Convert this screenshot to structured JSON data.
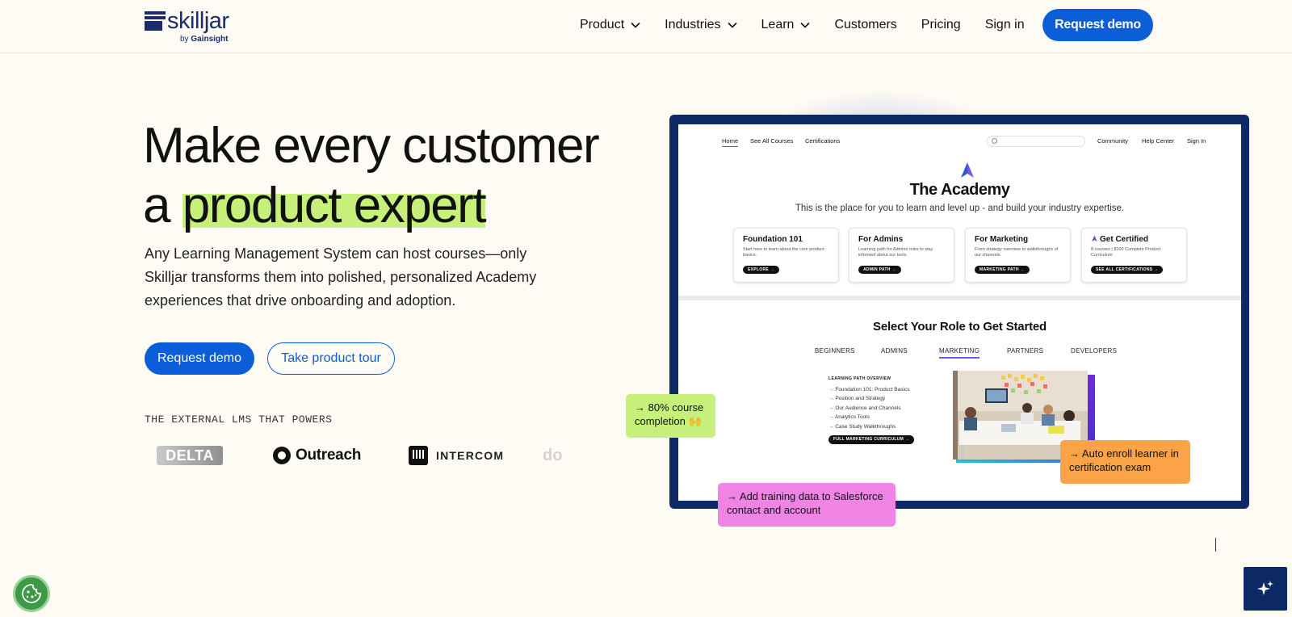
{
  "header": {
    "logo_word": "skilljar",
    "logo_by": "by",
    "logo_by_brand": "Gainsight",
    "nav": [
      {
        "label": "Product",
        "has_dropdown": true
      },
      {
        "label": "Industries",
        "has_dropdown": true
      },
      {
        "label": "Learn",
        "has_dropdown": true
      },
      {
        "label": "Customers",
        "has_dropdown": false
      },
      {
        "label": "Pricing",
        "has_dropdown": false
      },
      {
        "label": "Sign in",
        "has_dropdown": false
      }
    ],
    "cta": "Request demo"
  },
  "hero": {
    "title_line1": "Make every customer",
    "title_line2_prefix": "a ",
    "title_line2_highlight": "product expert",
    "lede": "Any Learning Management System can host courses—only Skilljar transforms them into polished, personalized Academy experiences that drive onboarding and adoption.",
    "primary_cta": "Request demo",
    "secondary_cta": "Take product tour",
    "powers_label": "THE EXTERNAL LMS THAT POWERS",
    "customer_logos": [
      "DELTA",
      "Outreach",
      "INTERCOM",
      "do"
    ]
  },
  "mockup": {
    "nav": {
      "home": "Home",
      "courses": "See All Courses",
      "certs": "Certifications",
      "community": "Community",
      "help": "Help Center",
      "signin": "Sign In"
    },
    "title": "The Academy",
    "subtitle": "This is the place for you to learn and level up - and build your industry expertise.",
    "cards": [
      {
        "title": "Foundation 101",
        "desc": "Start here to learn about the core product basics.",
        "button": "EXPLORE →"
      },
      {
        "title": "For Admins",
        "desc": "Learning path for Admins roles to stay informed about our tools.",
        "button": "ADMIN PATH →"
      },
      {
        "title": "For Marketing",
        "desc": "From strategy overview to walkthroughs of our channels.",
        "button": "MARKETING PATH →"
      },
      {
        "title": "Get Certified",
        "desc": "8 courses | $100 Complete Product Curriculum",
        "button": "SEE ALL CERTIFICATIONS →"
      }
    ],
    "role_heading": "Select Your Role to Get Started",
    "tabs": [
      "BEGINNERS",
      "ADMINS",
      "MARKETING",
      "PARTNERS",
      "DEVELOPERS"
    ],
    "active_tab": "MARKETING",
    "path_heading": "LEARNING PATH OVERVIEW",
    "path_items": [
      "Foundation 101: Product Basics",
      "Position and Strategy",
      "Our Audience and Channels",
      "Analytics Tools",
      "Case Study Walkthroughs"
    ],
    "path_button": "FULL MARKETING CURRICULUM →"
  },
  "callouts": {
    "green": "→ 80% course completion 🙌",
    "orange": "→ Auto enroll learner in certification exam",
    "pink": "→ Add training data to Salesforce contact and account"
  },
  "colors": {
    "background": "#fdfbf3",
    "brand_blue": "#0b5ed7",
    "navy": "#0e2a66",
    "highlight_green": "#c6f07a",
    "orange": "#fba346",
    "pink": "#f084e4"
  }
}
